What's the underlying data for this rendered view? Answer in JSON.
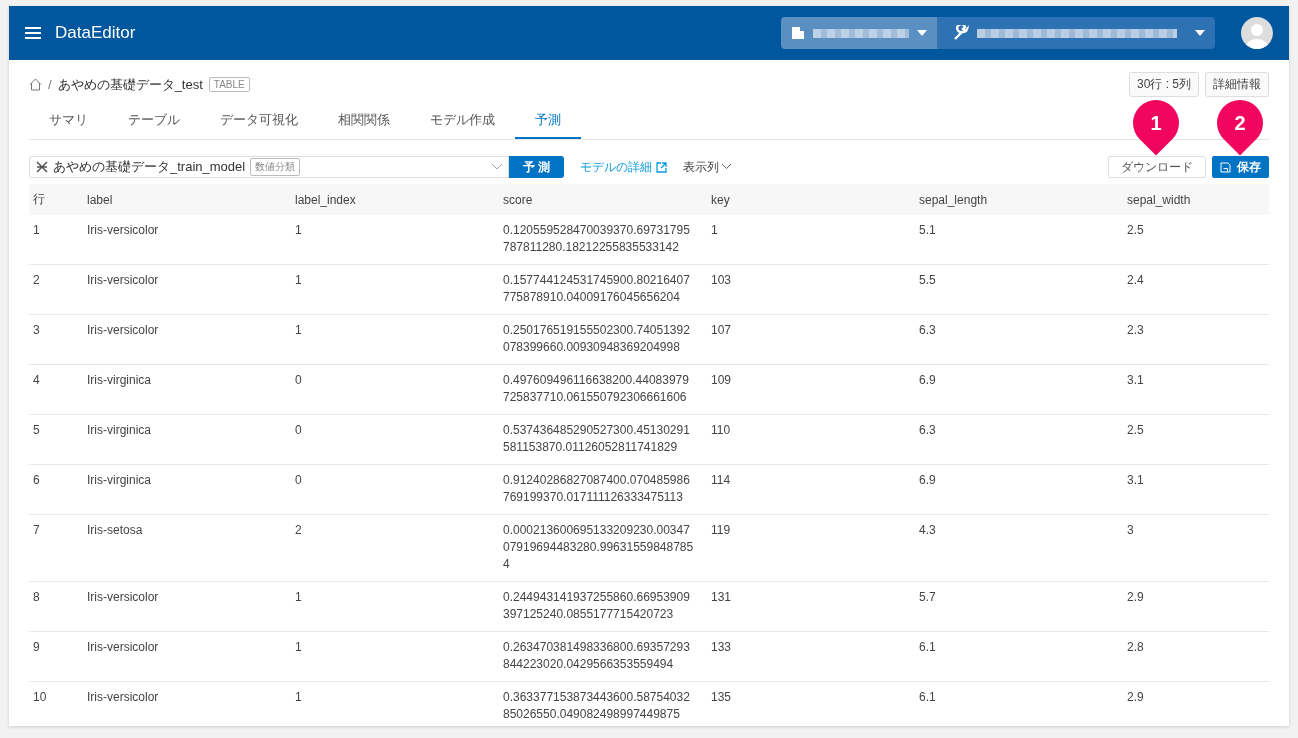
{
  "app": {
    "title": "DataEditor"
  },
  "breadcrumb": {
    "separator": "/",
    "name": "あやめの基礎データ_test",
    "tag": "TABLE"
  },
  "info_buttons": [
    "30行 : 5列",
    "詳細情報"
  ],
  "tabs": [
    {
      "label": "サマリ",
      "selected": false
    },
    {
      "label": "テーブル",
      "selected": false
    },
    {
      "label": "データ可視化",
      "selected": false
    },
    {
      "label": "相関関係",
      "selected": false
    },
    {
      "label": "モデル作成",
      "selected": false
    },
    {
      "label": "予測",
      "selected": true
    }
  ],
  "toolbar": {
    "model": "あやめの基礎データ_train_model",
    "model_tag": "数値分類",
    "predict_button": "予 測",
    "model_link": "モデルの詳細",
    "columns_menu": "表示列",
    "download_button": "ダウンロード",
    "save_button": "保存"
  },
  "callouts": [
    "1",
    "2"
  ],
  "table": {
    "columns": [
      "行",
      "label",
      "label_index",
      "score",
      "key",
      "sepal_length",
      "sepal_width"
    ],
    "rows": [
      [
        "1",
        "Iris-versicolor",
        "1",
        "0.120559528470039370.69731795787811280.18212255835533142",
        "1",
        "5.1",
        "2.5"
      ],
      [
        "2",
        "Iris-versicolor",
        "1",
        "0.157744124531745900.80216407775878910.04009176045656204",
        "103",
        "5.5",
        "2.4"
      ],
      [
        "3",
        "Iris-versicolor",
        "1",
        "0.250176519155502300.74051392078399660.00930948369204998",
        "107",
        "6.3",
        "2.3"
      ],
      [
        "4",
        "Iris-virginica",
        "0",
        "0.497609496116638200.44083979725837710.061550792306661606",
        "109",
        "6.9",
        "3.1"
      ],
      [
        "5",
        "Iris-virginica",
        "0",
        "0.537436485290527300.45130291581153870.01126052811741829",
        "110",
        "6.3",
        "2.5"
      ],
      [
        "6",
        "Iris-virginica",
        "0",
        "0.91240286827087400.070485986769199370.017111126333475113",
        "114",
        "6.9",
        "3.1"
      ],
      [
        "7",
        "Iris-setosa",
        "2",
        "0.000213600695133209230.0034707919694483280.996315598487854",
        "119",
        "4.3",
        "3"
      ],
      [
        "8",
        "Iris-versicolor",
        "1",
        "0.244943141937255860.66953909397125240.0855177715420723",
        "131",
        "5.7",
        "2.9"
      ],
      [
        "9",
        "Iris-versicolor",
        "1",
        "0.263470381498336800.69357293844223020.0429566353559494",
        "133",
        "6.1",
        "2.8"
      ],
      [
        "10",
        "Iris-versicolor",
        "1",
        "0.363377153873443600.5875403285026550.049082498997449875",
        "135",
        "6.1",
        "2.9"
      ]
    ]
  }
}
